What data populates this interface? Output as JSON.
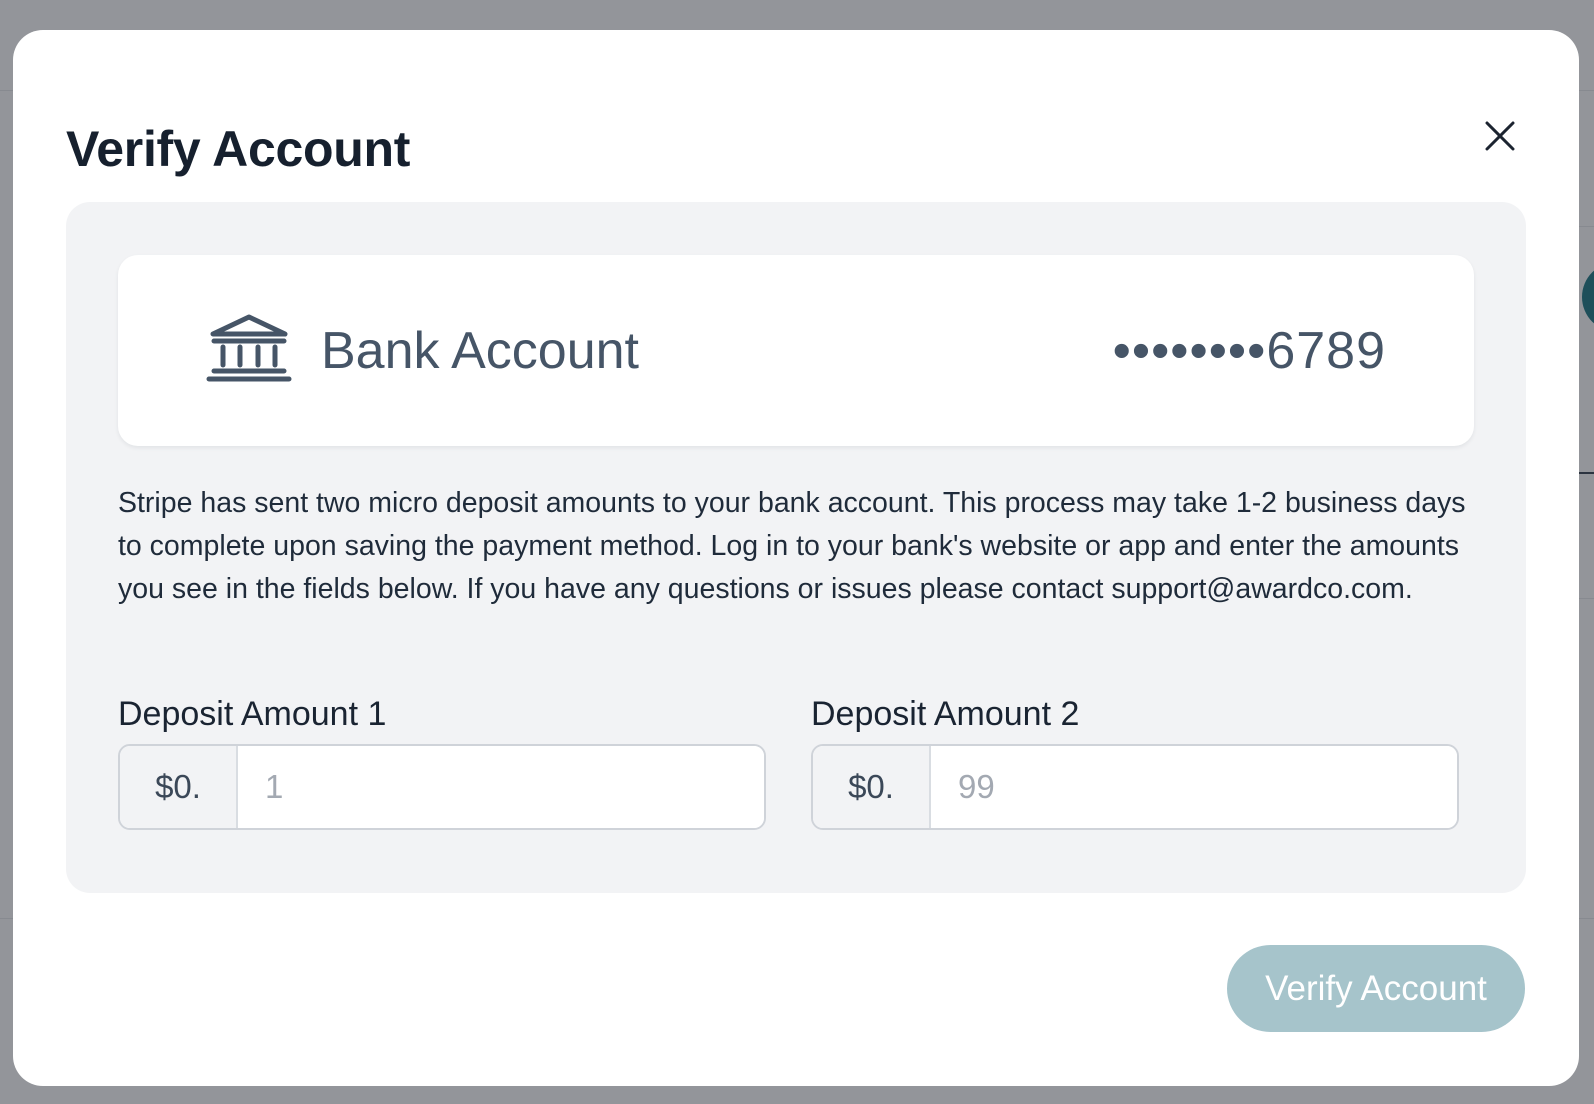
{
  "colors": {
    "overlay": "#93959a",
    "title": "#16202e",
    "panel_background": "#f2f3f5",
    "bank_text": "#465567",
    "button_disabled": "#a6c4cb"
  },
  "modal": {
    "title": "Verify Account",
    "close_icon": "close-icon"
  },
  "bank_account": {
    "icon": "bank-icon",
    "label": "Bank Account",
    "masked_number": "••••••••6789"
  },
  "description": "Stripe has sent two micro deposit amounts to your bank account. This process may take 1-2 business days to complete upon saving the payment method. Log in to your bank's website or app and enter the amounts you see in the fields below. If you have any questions or issues please contact support@awardco.com.",
  "deposits": [
    {
      "label": "Deposit Amount 1",
      "prefix": "$0.",
      "placeholder": "1",
      "value": ""
    },
    {
      "label": "Deposit Amount 2",
      "prefix": "$0.",
      "placeholder": "99",
      "value": ""
    }
  ],
  "actions": {
    "verify_label": "Verify Account",
    "verify_enabled": false
  }
}
